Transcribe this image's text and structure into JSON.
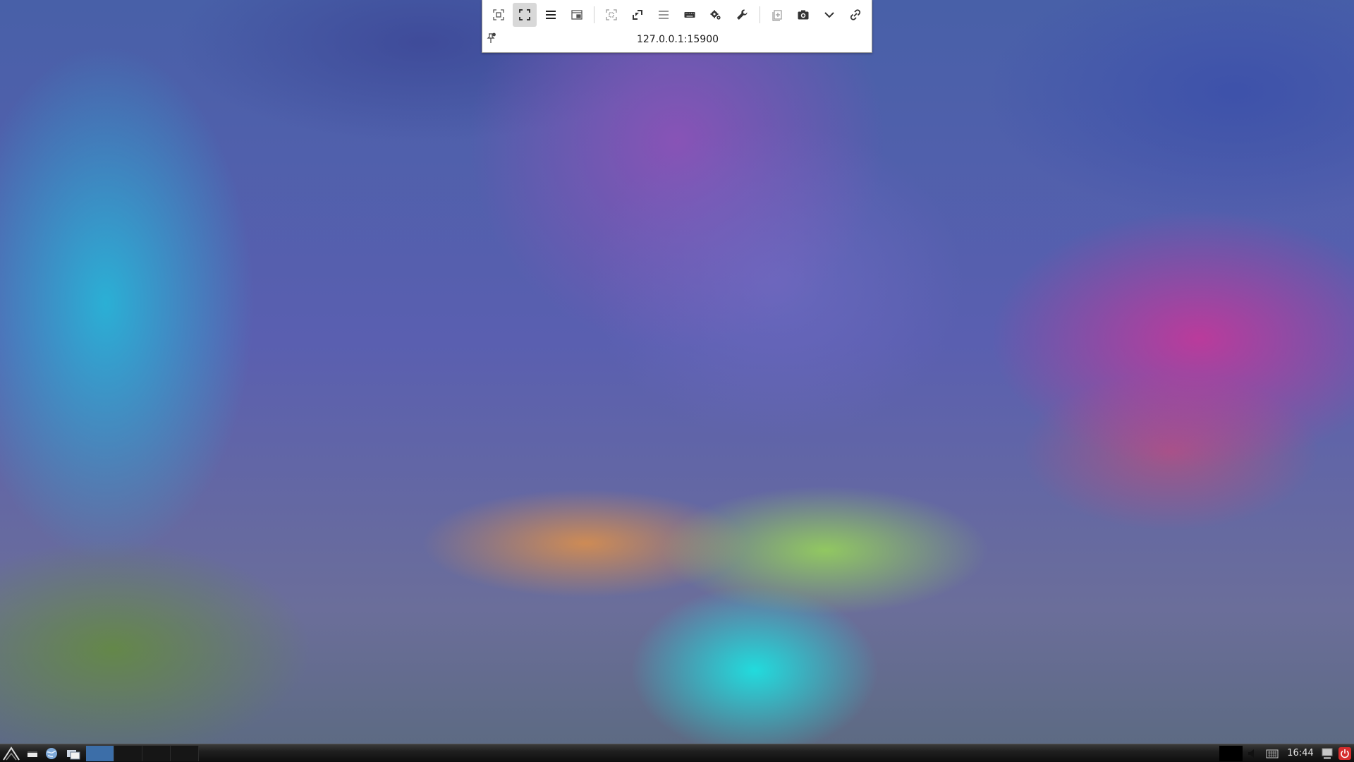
{
  "vnc_toolbar": {
    "host": "127.0.0.1:15900",
    "buttons": [
      {
        "name": "fit-to-window-button",
        "icon": "fit-screen-icon",
        "active": false
      },
      {
        "name": "fullscreen-button",
        "icon": "fullscreen-icon",
        "active": true
      },
      {
        "name": "menu-button",
        "icon": "hamburger-icon",
        "active": false
      },
      {
        "name": "window-mode-button",
        "icon": "window-icon",
        "active": false
      },
      {
        "name": "scaled-button",
        "icon": "scale-icon",
        "active": false
      },
      {
        "name": "fullscreen-toggle-button",
        "icon": "expand-icon",
        "active": false
      },
      {
        "name": "preferences-list-button",
        "icon": "list-icon",
        "active": false
      },
      {
        "name": "keyboard-button",
        "icon": "keyboard-icon",
        "active": false
      },
      {
        "name": "settings-button",
        "icon": "gears-icon",
        "active": false
      },
      {
        "name": "tools-button",
        "icon": "wrench-icon",
        "active": false
      },
      {
        "name": "duplicate-button",
        "icon": "copy-icon",
        "active": false
      },
      {
        "name": "screenshot-button",
        "icon": "camera-icon",
        "active": false
      },
      {
        "name": "more-button",
        "icon": "chevron-down-icon",
        "active": false
      },
      {
        "name": "disconnect-button",
        "icon": "broken-link-icon",
        "active": false
      }
    ]
  },
  "taskbar": {
    "clock": "16:44",
    "desktops": [
      "1",
      "2",
      "3",
      "4"
    ],
    "active_desktop": 1
  },
  "colors": {
    "toolbar_bg": "#ffffff",
    "active_button_bg": "#d8d8d8",
    "taskbar_bg": "#1a1a1a",
    "active_desktop": "#3c6ea8",
    "power_button": "#d62d2d"
  }
}
